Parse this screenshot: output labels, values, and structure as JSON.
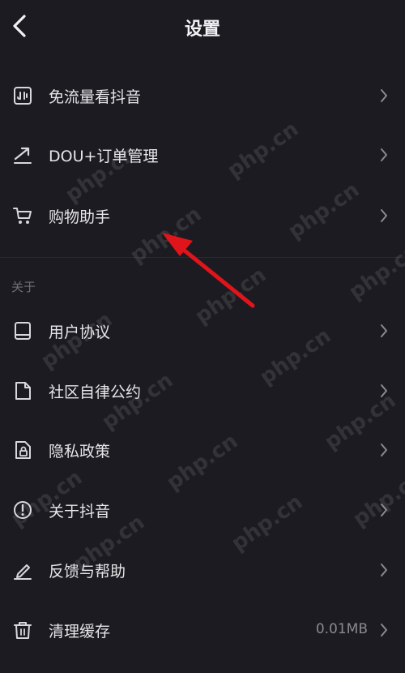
{
  "header": {
    "title": "设置"
  },
  "menu_top": [
    {
      "label": "免流量看抖音",
      "icon": "flow-free-icon"
    },
    {
      "label": "DOU+订单管理",
      "icon": "trend-arrow-icon"
    },
    {
      "label": "购物助手",
      "icon": "shopping-cart-icon"
    }
  ],
  "section_about": {
    "label": "关于"
  },
  "menu_about": [
    {
      "label": "用户协议",
      "icon": "book-icon"
    },
    {
      "label": "社区自律公约",
      "icon": "document-icon"
    },
    {
      "label": "隐私政策",
      "icon": "privacy-lock-icon"
    },
    {
      "label": "关于抖音",
      "icon": "info-icon"
    },
    {
      "label": "反馈与帮助",
      "icon": "pencil-icon"
    },
    {
      "label": "清理缓存",
      "icon": "trash-icon",
      "value": "0.01MB"
    }
  ],
  "watermark": {
    "text": "php.cn"
  },
  "colors": {
    "background": "#1c1b21",
    "text": "#e6e6e8",
    "muted": "#8a8a90",
    "annotation_arrow": "#e0141b"
  }
}
